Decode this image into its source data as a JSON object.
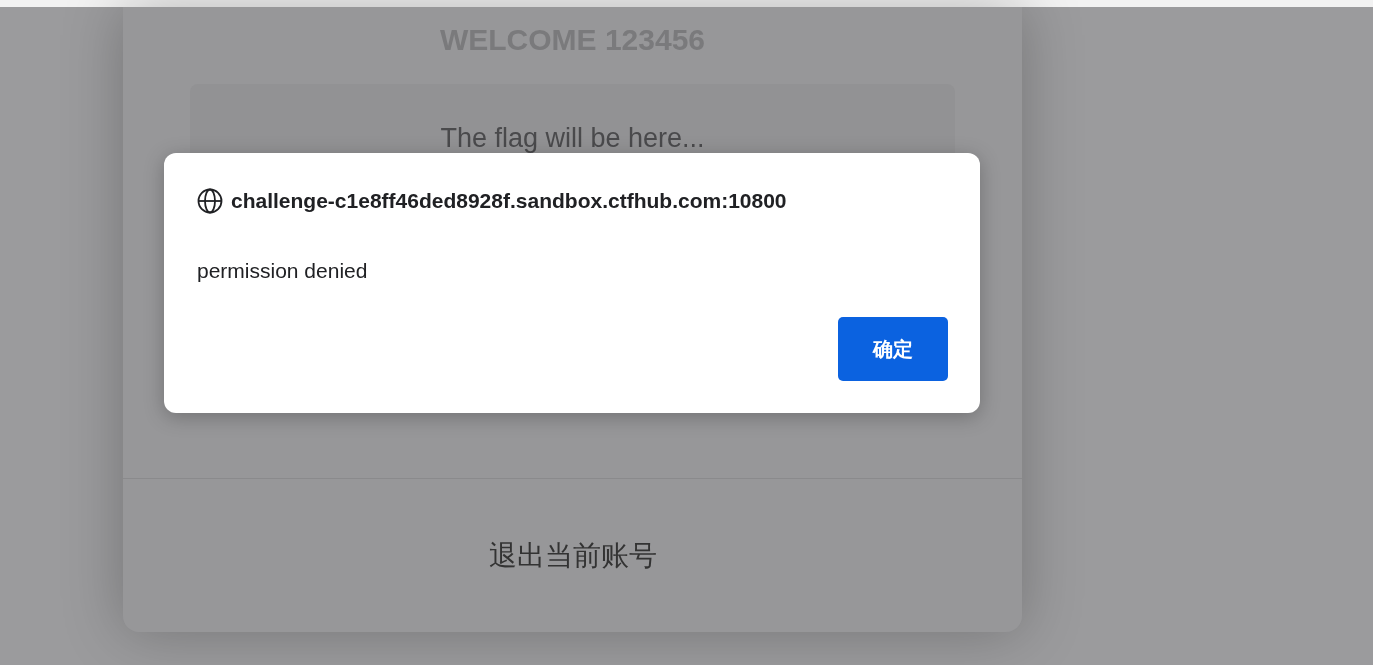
{
  "page": {
    "welcome": "WELCOME 123456",
    "flag_placeholder": "The flag will be here...",
    "logout_link": "退出当前账号"
  },
  "dialog": {
    "origin": "challenge-c1e8ff46ded8928f.sandbox.ctfhub.com:10800",
    "message": "permission denied",
    "buttons": [
      {
        "label": "确定"
      }
    ]
  }
}
